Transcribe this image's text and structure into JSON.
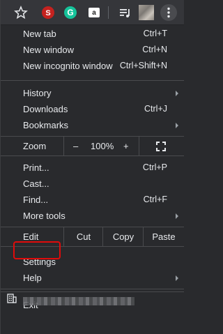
{
  "toolbar": {
    "icons": [
      "star-icon",
      "extension-icon-1",
      "grammarly-icon",
      "extension-icon-2",
      "reading-list-icon",
      "profile-avatar",
      "more-menu-icon"
    ]
  },
  "menu": {
    "new_tab": {
      "label": "New tab",
      "shortcut": "Ctrl+T"
    },
    "new_window": {
      "label": "New window",
      "shortcut": "Ctrl+N"
    },
    "new_incognito": {
      "label": "New incognito window",
      "shortcut": "Ctrl+Shift+N"
    },
    "history": {
      "label": "History"
    },
    "downloads": {
      "label": "Downloads",
      "shortcut": "Ctrl+J"
    },
    "bookmarks": {
      "label": "Bookmarks"
    },
    "zoom": {
      "label": "Zoom",
      "minus": "–",
      "level": "100%",
      "plus": "+"
    },
    "print": {
      "label": "Print...",
      "shortcut": "Ctrl+P"
    },
    "cast": {
      "label": "Cast..."
    },
    "find": {
      "label": "Find...",
      "shortcut": "Ctrl+F"
    },
    "more_tools": {
      "label": "More tools"
    },
    "edit": {
      "label": "Edit",
      "cut": "Cut",
      "copy": "Copy",
      "paste": "Paste"
    },
    "settings": {
      "label": "Settings"
    },
    "help": {
      "label": "Help"
    },
    "exit": {
      "label": "Exit"
    }
  },
  "colors": {
    "background": "#292a2d",
    "highlight_border": "#e00b0b",
    "text": "#e8eaed"
  }
}
